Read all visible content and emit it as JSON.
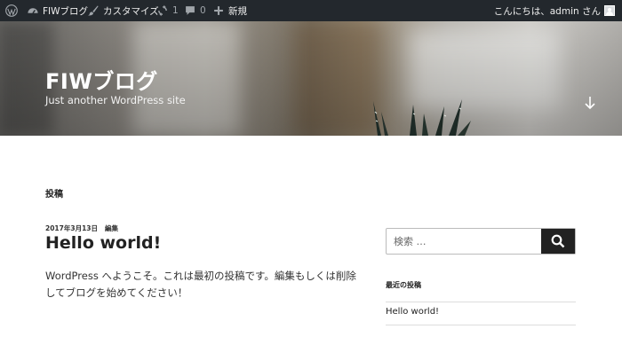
{
  "adminbar": {
    "site_name": "FIWブログ",
    "customize": "カスタマイズ",
    "updates_count": "1",
    "comments_count": "0",
    "new_label": "新規",
    "greeting": "こんにちは、admin さん"
  },
  "header": {
    "site_title": "FIWブログ",
    "tagline": "Just another WordPress site"
  },
  "main": {
    "page_heading": "投稿",
    "post": {
      "date": "2017年3月13日",
      "edit_label": "編集",
      "title": "Hello world!",
      "body": "WordPress へようこそ。これは最初の投稿です。編集もしくは削除してブログを始めてください！"
    }
  },
  "sidebar": {
    "search_placeholder": "検索 …",
    "recent_title": "最近の投稿",
    "recent_posts": [
      "Hello world!"
    ]
  },
  "colors": {
    "adminbar_bg": "#23282d",
    "search_button_bg": "#222222"
  }
}
